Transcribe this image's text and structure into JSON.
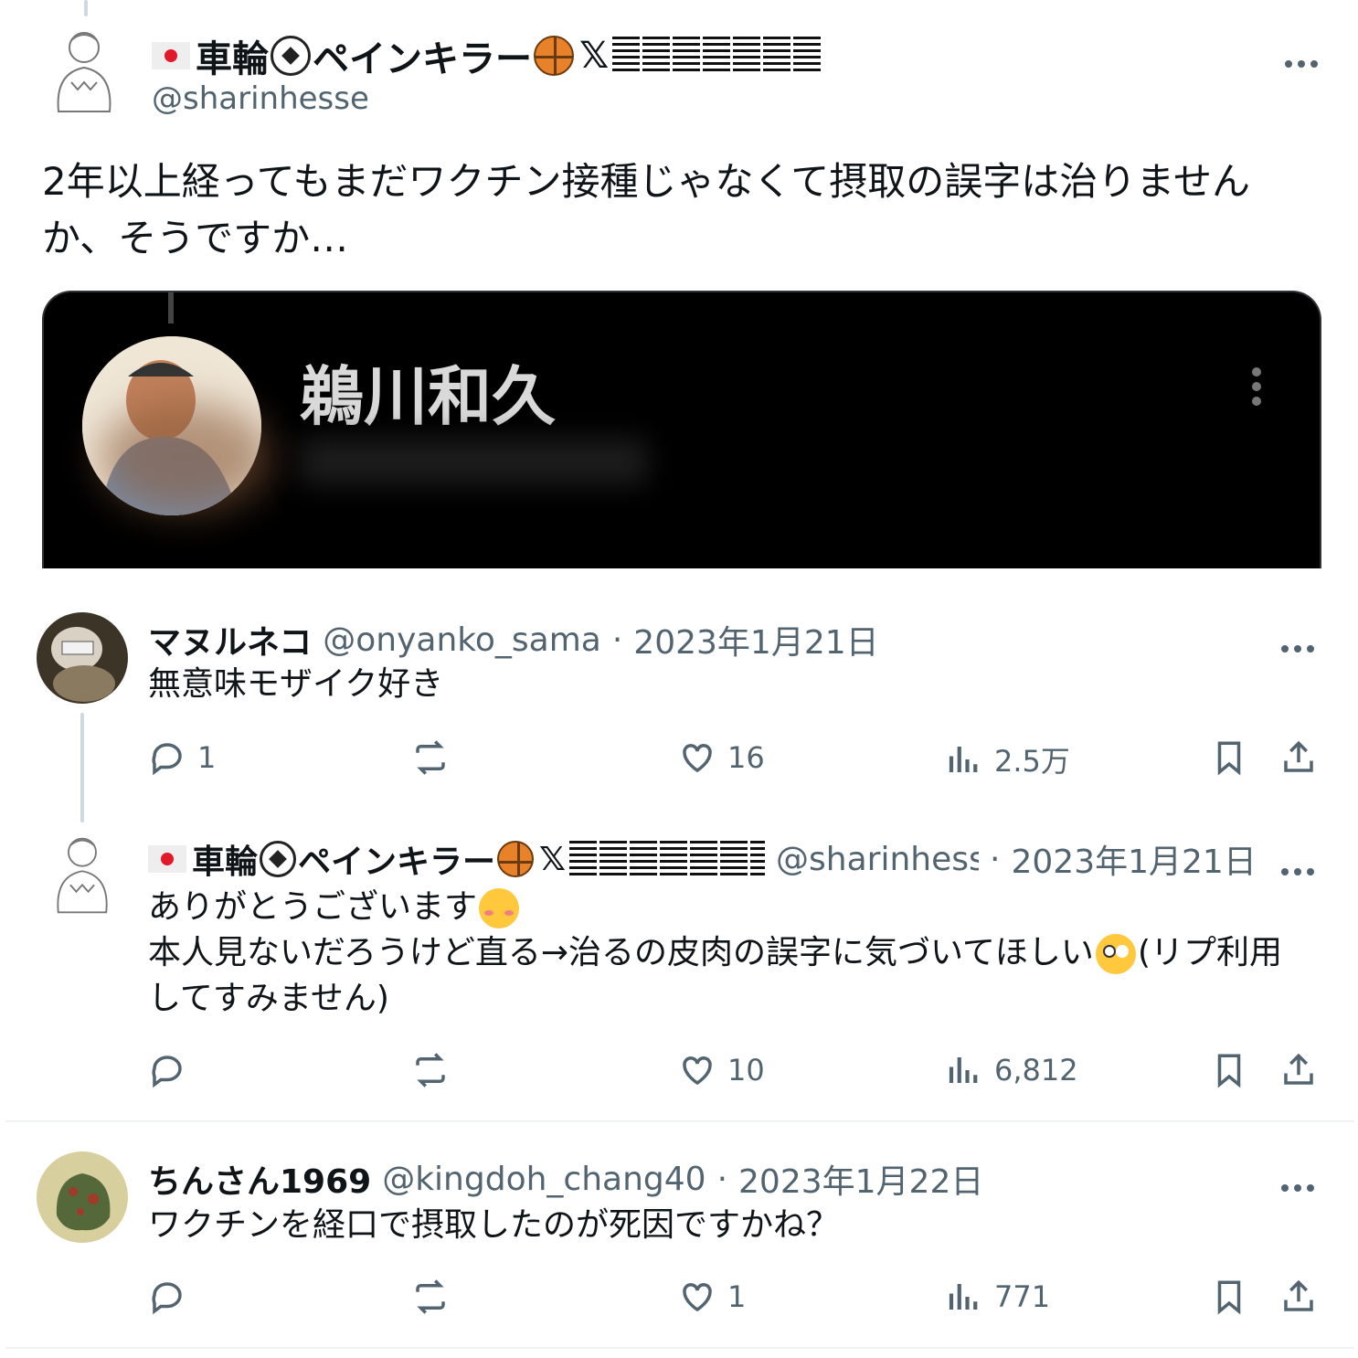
{
  "main_tweet": {
    "display_name": "車輪",
    "display_name_suffix": "ペインキラー",
    "handle": "@sharinhesse",
    "text": "2年以上経ってもまだワクチン接種じゃなくて摂取の誤字は治りませんか、そうですか…",
    "media": {
      "title": "鵜川和久"
    }
  },
  "replies": [
    {
      "display_name": "マヌルネコ",
      "handle": "@onyanko_sama",
      "date": "2023年1月21日",
      "text": "無意味モザイク好き",
      "stats": {
        "replies": "1",
        "reposts": "",
        "likes": "16",
        "views": "2.5万"
      }
    },
    {
      "display_name": "車輪",
      "display_name_suffix": "ペインキラー",
      "handle": "@sharinhesse",
      "date": "2023年1月21日",
      "text_line1": "ありがとうございます",
      "text_line2a": "本人見ないだろうけど直る→治るの皮肉の誤字に気づいてほしい",
      "text_line2b": "(リプ利用",
      "text_line3": "してすみません)",
      "stats": {
        "replies": "",
        "reposts": "",
        "likes": "10",
        "views": "6,812"
      }
    },
    {
      "display_name": "ちんさん1969",
      "handle": "@kingdoh_chang40",
      "date": "2023年1月22日",
      "text": "ワクチンを経口で摂取したのが死因ですかね？",
      "stats": {
        "replies": "",
        "reposts": "",
        "likes": "1",
        "views": "771"
      }
    }
  ],
  "ui": {
    "separator": "·",
    "x_glyph": "𝕏"
  },
  "icons": [
    "more-icon",
    "reply-icon",
    "repost-icon",
    "like-icon",
    "views-icon",
    "bookmark-icon",
    "share-icon"
  ],
  "colors": {
    "secondary_text": "#536471",
    "thread_line": "#cfd9de",
    "divider": "#eff3f4"
  }
}
